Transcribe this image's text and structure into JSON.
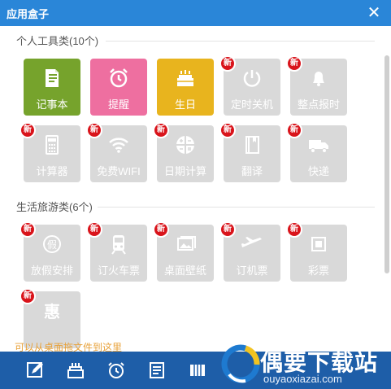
{
  "window": {
    "title": "应用盒子",
    "close_icon": "close-icon"
  },
  "sections": [
    {
      "title": "个人工具类(10个)",
      "tiles": [
        {
          "label": "记事本",
          "icon": "notepad-icon",
          "color": "#76a32c",
          "new": false
        },
        {
          "label": "提醒",
          "icon": "alarm-clock-icon",
          "color": "#ee6fa0",
          "new": false
        },
        {
          "label": "生日",
          "icon": "birthday-cake-icon",
          "color": "#e8b41e",
          "new": false
        },
        {
          "label": "定时关机",
          "icon": "power-icon",
          "color": "#d9d9d9",
          "new": true
        },
        {
          "label": "整点报时",
          "icon": "bell-icon",
          "color": "#d9d9d9",
          "new": true
        },
        {
          "label": "计算器",
          "icon": "calculator-icon",
          "color": "#d9d9d9",
          "new": true
        },
        {
          "label": "免费WIFI",
          "icon": "wifi-icon",
          "color": "#d9d9d9",
          "new": true
        },
        {
          "label": "日期计算",
          "icon": "date-calc-icon",
          "color": "#d9d9d9",
          "new": true
        },
        {
          "label": "翻译",
          "icon": "book-icon",
          "color": "#d9d9d9",
          "new": true
        },
        {
          "label": "快递",
          "icon": "truck-icon",
          "color": "#d9d9d9",
          "new": true
        }
      ]
    },
    {
      "title": "生活旅游类(6个)",
      "tiles": [
        {
          "label": "放假安排",
          "icon": "holiday-icon",
          "color": "#d9d9d9",
          "new": true
        },
        {
          "label": "订火车票",
          "icon": "train-icon",
          "color": "#d9d9d9",
          "new": true
        },
        {
          "label": "桌面壁纸",
          "icon": "wallpaper-icon",
          "color": "#d9d9d9",
          "new": true
        },
        {
          "label": "订机票",
          "icon": "airplane-icon",
          "color": "#d9d9d9",
          "new": true
        },
        {
          "label": "彩票",
          "icon": "lottery-icon",
          "color": "#d9d9d9",
          "new": true
        },
        {
          "label": "",
          "icon": "discount-icon",
          "color": "#d9d9d9",
          "new": true
        }
      ]
    }
  ],
  "badge_text": "新",
  "drag_hint": "可以从桌面拖文件到这里",
  "dock": [
    {
      "icon": "edit-icon"
    },
    {
      "icon": "birthday-cake-icon"
    },
    {
      "icon": "alarm-clock-icon"
    },
    {
      "icon": "document-icon"
    },
    {
      "icon": "ticket-icon"
    }
  ],
  "watermark": {
    "name": "偶要下载站",
    "url": "ouyaoxiazai.com"
  }
}
